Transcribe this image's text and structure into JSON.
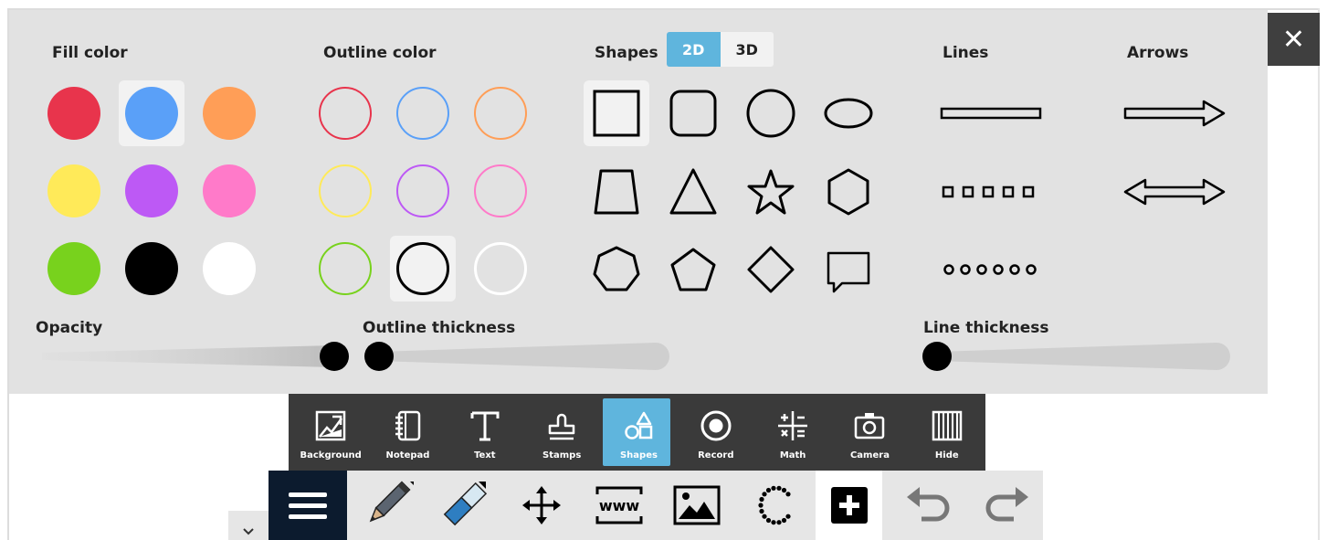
{
  "close_label": "✕",
  "sections": {
    "fill_color": "Fill color",
    "outline_color": "Outline color",
    "shapes": "Shapes",
    "lines": "Lines",
    "arrows": "Arrows"
  },
  "mode_toggle": {
    "option_2d": "2D",
    "option_3d": "3D",
    "selected": "2D"
  },
  "fill_colors": [
    "#e8344c",
    "#5aa0f8",
    "#ff9e57",
    "#ffea59",
    "#bd59f5",
    "#ff7ac9",
    "#78d21d",
    "#000000",
    "#ffffff"
  ],
  "fill_selected": 1,
  "outline_colors": [
    "#e8344c",
    "#5aa0f8",
    "#ff9e57",
    "#ffea59",
    "#bd59f5",
    "#ff7ac9",
    "#78d21d",
    "#000000",
    "#ffffff"
  ],
  "outline_selected": 7,
  "shapes": [
    "square",
    "rounded-square",
    "circle",
    "ellipse",
    "trapezoid",
    "triangle",
    "star",
    "hexagon",
    "heptagon",
    "pentagon",
    "diamond",
    "speech-bubble"
  ],
  "shape_selected": 0,
  "lines": [
    "solid-line",
    "dashed-line",
    "dotted-line"
  ],
  "arrows": [
    "single-arrow",
    "double-arrow"
  ],
  "sliders": {
    "opacity_label": "Opacity",
    "opacity_value": 1.0,
    "outline_thickness_label": "Outline thickness",
    "outline_thickness_value": 0.0,
    "line_thickness_label": "Line thickness",
    "line_thickness_value": 0.0
  },
  "toolbar_top": {
    "active": "Shapes",
    "items": [
      {
        "label": "Background",
        "icon": "background-icon"
      },
      {
        "label": "Notepad",
        "icon": "notepad-icon"
      },
      {
        "label": "Text",
        "icon": "text-icon"
      },
      {
        "label": "Stamps",
        "icon": "stamp-icon"
      },
      {
        "label": "Shapes",
        "icon": "shapes-icon"
      },
      {
        "label": "Record",
        "icon": "record-icon"
      },
      {
        "label": "Math",
        "icon": "math-icon"
      },
      {
        "label": "Camera",
        "icon": "camera-icon"
      },
      {
        "label": "Hide",
        "icon": "hide-icon"
      }
    ]
  },
  "toolbar_bottom": {
    "www_label": "www",
    "items": [
      "menu-icon",
      "pen-icon",
      "eraser-icon",
      "move-icon",
      "web-icon",
      "image-icon",
      "lasso-icon",
      "add-icon",
      "undo-icon",
      "redo-icon"
    ]
  },
  "colors": {
    "accent": "#5fb5dd",
    "panel": "#e2e2e2",
    "toolbar_dark": "#3a3a3a",
    "menu_dark": "#0c1b2e"
  }
}
